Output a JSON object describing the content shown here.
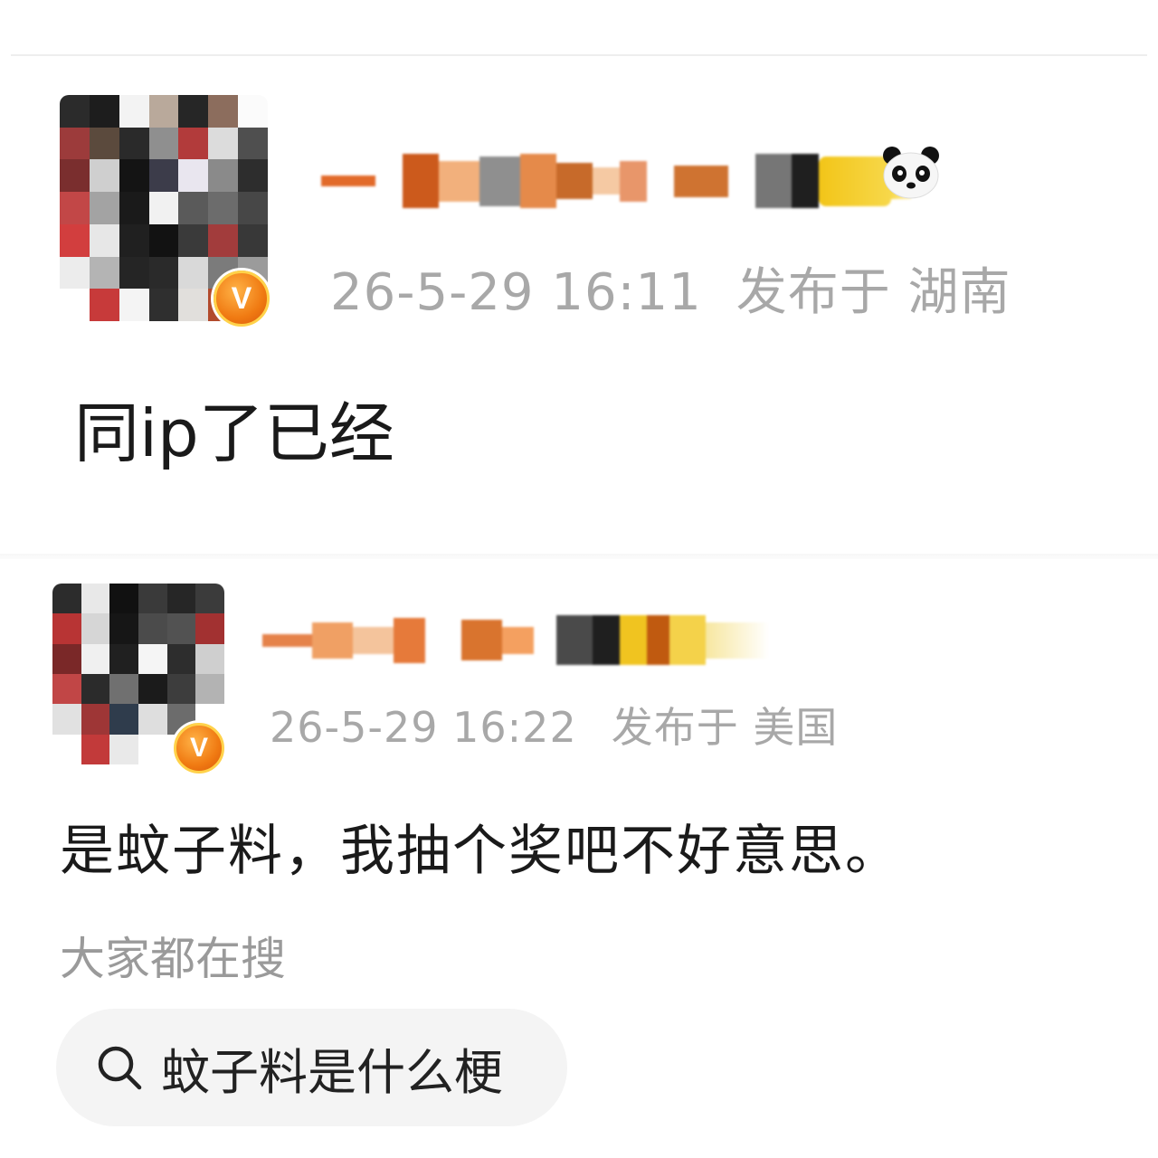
{
  "colors": {
    "background": "#ffffff",
    "meta_text": "#a8a8a8",
    "body_text": "#1a1a1a",
    "suggest_title": "#9a9a9a",
    "chip_bg": "#f4f4f4",
    "vip_orange": "#f07a12"
  },
  "comments": [
    {
      "avatar_icon": "avatar-image-pixelated",
      "vip_badge": "V",
      "meta": {
        "datetime": "26-5-29 16:11",
        "location": "发布于 湖南"
      },
      "text": "同ip了已经"
    },
    {
      "avatar_icon": "avatar-image-pixelated",
      "vip_badge": "V",
      "meta": {
        "datetime": "26-5-29 16:22",
        "location": "发布于 美国"
      },
      "text": "是蚊子料，我抽个奖吧不好意思。"
    }
  ],
  "suggestions": {
    "title": "大家都在搜",
    "items": [
      {
        "icon": "search-icon",
        "label": "蚊子料是什么梗"
      }
    ]
  }
}
